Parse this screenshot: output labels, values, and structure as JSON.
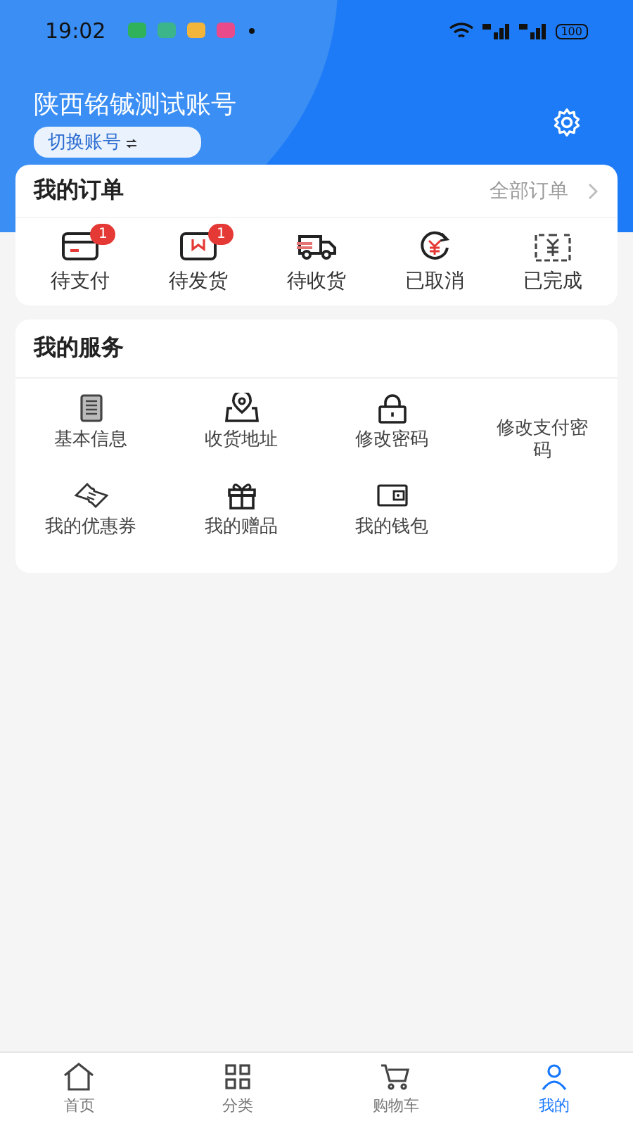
{
  "status_bar": {
    "time": "19:02",
    "battery": "100"
  },
  "header": {
    "account_name": "陕西铭铖测试账号",
    "switch_label": "切换账号"
  },
  "orders": {
    "title": "我的订单",
    "all_link": "全部订单",
    "items": [
      {
        "kind": "pay",
        "label": "待支付",
        "badge": "1"
      },
      {
        "kind": "ship",
        "label": "待发货",
        "badge": "1"
      },
      {
        "kind": "receive",
        "label": "待收货"
      },
      {
        "kind": "cancel",
        "label": "已取消"
      },
      {
        "kind": "done",
        "label": "已完成"
      }
    ]
  },
  "services": {
    "title": "我的服务",
    "items": [
      {
        "kind": "info",
        "label": "基本信息"
      },
      {
        "kind": "address",
        "label": "收货地址"
      },
      {
        "kind": "lock",
        "label": "修改密码"
      },
      {
        "kind": "lock2",
        "label": "修改支付密码"
      },
      {
        "kind": "coupon",
        "label": "我的优惠券"
      },
      {
        "kind": "gift",
        "label": "我的赠品"
      },
      {
        "kind": "wallet",
        "label": "我的钱包"
      }
    ]
  },
  "tab_bar": [
    {
      "kind": "home",
      "label": "首页",
      "selected": false
    },
    {
      "kind": "category",
      "label": "分类",
      "selected": false
    },
    {
      "kind": "cart",
      "label": "购物车",
      "selected": false
    },
    {
      "kind": "me",
      "label": "我的",
      "selected": true
    }
  ]
}
